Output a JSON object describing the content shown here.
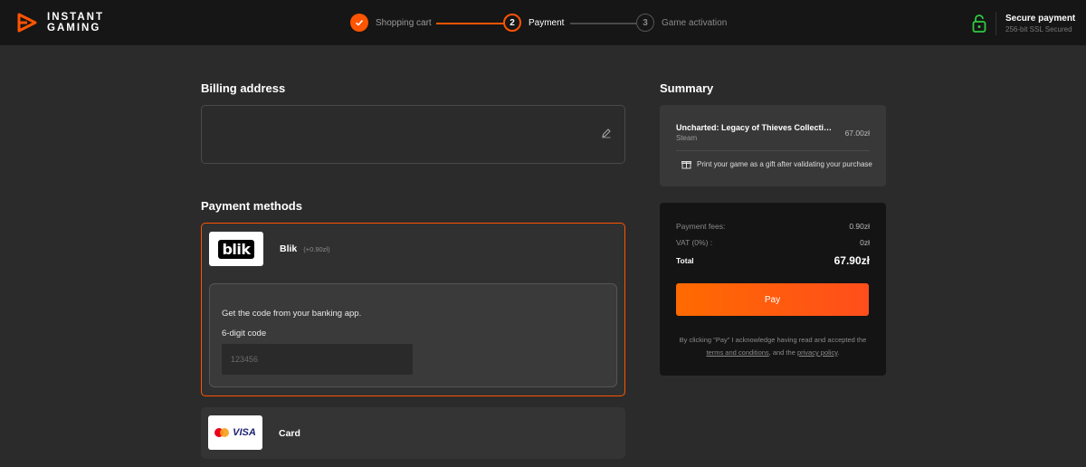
{
  "header": {
    "logo_line1": "INSTANT",
    "logo_line2": "GAMING",
    "steps": [
      {
        "number": "✓",
        "label": "Shopping cart",
        "state": "done"
      },
      {
        "number": "2",
        "label": "Payment",
        "state": "active"
      },
      {
        "number": "3",
        "label": "Game activation",
        "state": "pending"
      }
    ],
    "secure": {
      "title": "Secure payment",
      "subtitle": "256-bit SSL Secured"
    },
    "accent_color": "#ff5400"
  },
  "billing": {
    "title": "Billing address"
  },
  "payment_methods": {
    "title": "Payment methods",
    "blik": {
      "logo_text": "blik",
      "name": "Blik",
      "fee": "(+0.90zł)",
      "hint": "Get the code from your banking app.",
      "code_label": "6-digit code",
      "code_placeholder": "123456",
      "code_value": ""
    },
    "card": {
      "logo_text": "VISA",
      "name": "Card"
    }
  },
  "summary": {
    "title": "Summary",
    "product": {
      "name": "Uncharted: Legacy of Thieves Collectio...",
      "platform": "Steam",
      "price": "67.00zł"
    },
    "gift_text": "Print your game as a gift after validating your purchase",
    "payment_fees_label": "Payment fees:",
    "payment_fees_value": "0.90zł",
    "vat_label": "VAT (0%) :",
    "vat_value": "0zł",
    "total_label": "Total",
    "total_value": "67.90zł",
    "pay_button": "Pay",
    "legal_prefix": "By clicking \"Pay\" I acknowledge having read and accepted the ",
    "terms_link": "terms and conditions",
    "legal_middle": ", and the ",
    "privacy_link": "privacy policy",
    "legal_suffix": "."
  }
}
